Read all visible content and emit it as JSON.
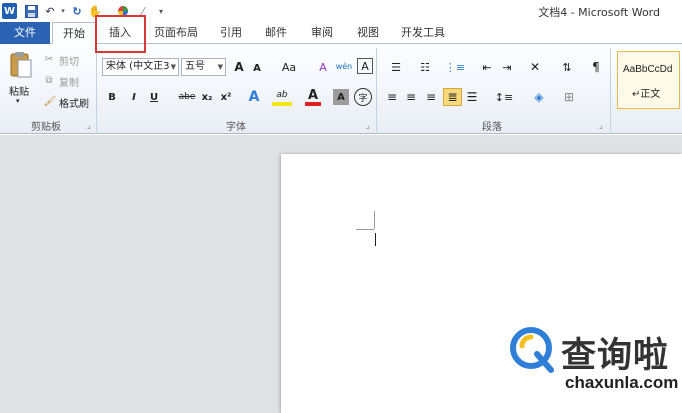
{
  "app": {
    "window_title": "文档4 - Microsoft Word",
    "logo": "W"
  },
  "quick_access": {
    "save_icon": "save-icon",
    "undo_icon": "undo-icon",
    "redo_icon": "redo-icon",
    "customize_icon": "customize-icon"
  },
  "tabs": [
    {
      "label": "文件"
    },
    {
      "label": "开始"
    },
    {
      "label": "插入"
    },
    {
      "label": "页面布局"
    },
    {
      "label": "引用"
    },
    {
      "label": "邮件"
    },
    {
      "label": "审阅"
    },
    {
      "label": "视图"
    },
    {
      "label": "开发工具"
    }
  ],
  "clipboard": {
    "paste": "粘贴",
    "cut": "剪切",
    "copy": "复制",
    "format_painter": "格式刷",
    "group_label": "剪贴板"
  },
  "font": {
    "font_name": "宋体 (中文正3",
    "font_size": "五号",
    "grow": "A",
    "shrink": "A",
    "change_case": "Aa",
    "clear_format": "A",
    "pinyin": "wén",
    "char_border": "A",
    "bold": "B",
    "italic": "I",
    "underline": "U",
    "strikethrough": "abe",
    "subscript": "x₂",
    "superscript": "x²",
    "text_effect": "A",
    "highlight": "ab",
    "font_color": "A",
    "char_shading": "A",
    "enclose": "字",
    "group_label": "字体"
  },
  "paragraph": {
    "group_label": "段落"
  },
  "styles": {
    "sample": "AaBbCcDd",
    "name": "正文"
  },
  "colors": {
    "file_tab": "#2b62b3",
    "highlight_box": "#d93838",
    "font_color": "#e02020",
    "highlight_color": "#f5e617",
    "watermark_blue": "#2f7fd8"
  },
  "watermark": {
    "name": "查询啦",
    "url": "chaxunla.com"
  }
}
